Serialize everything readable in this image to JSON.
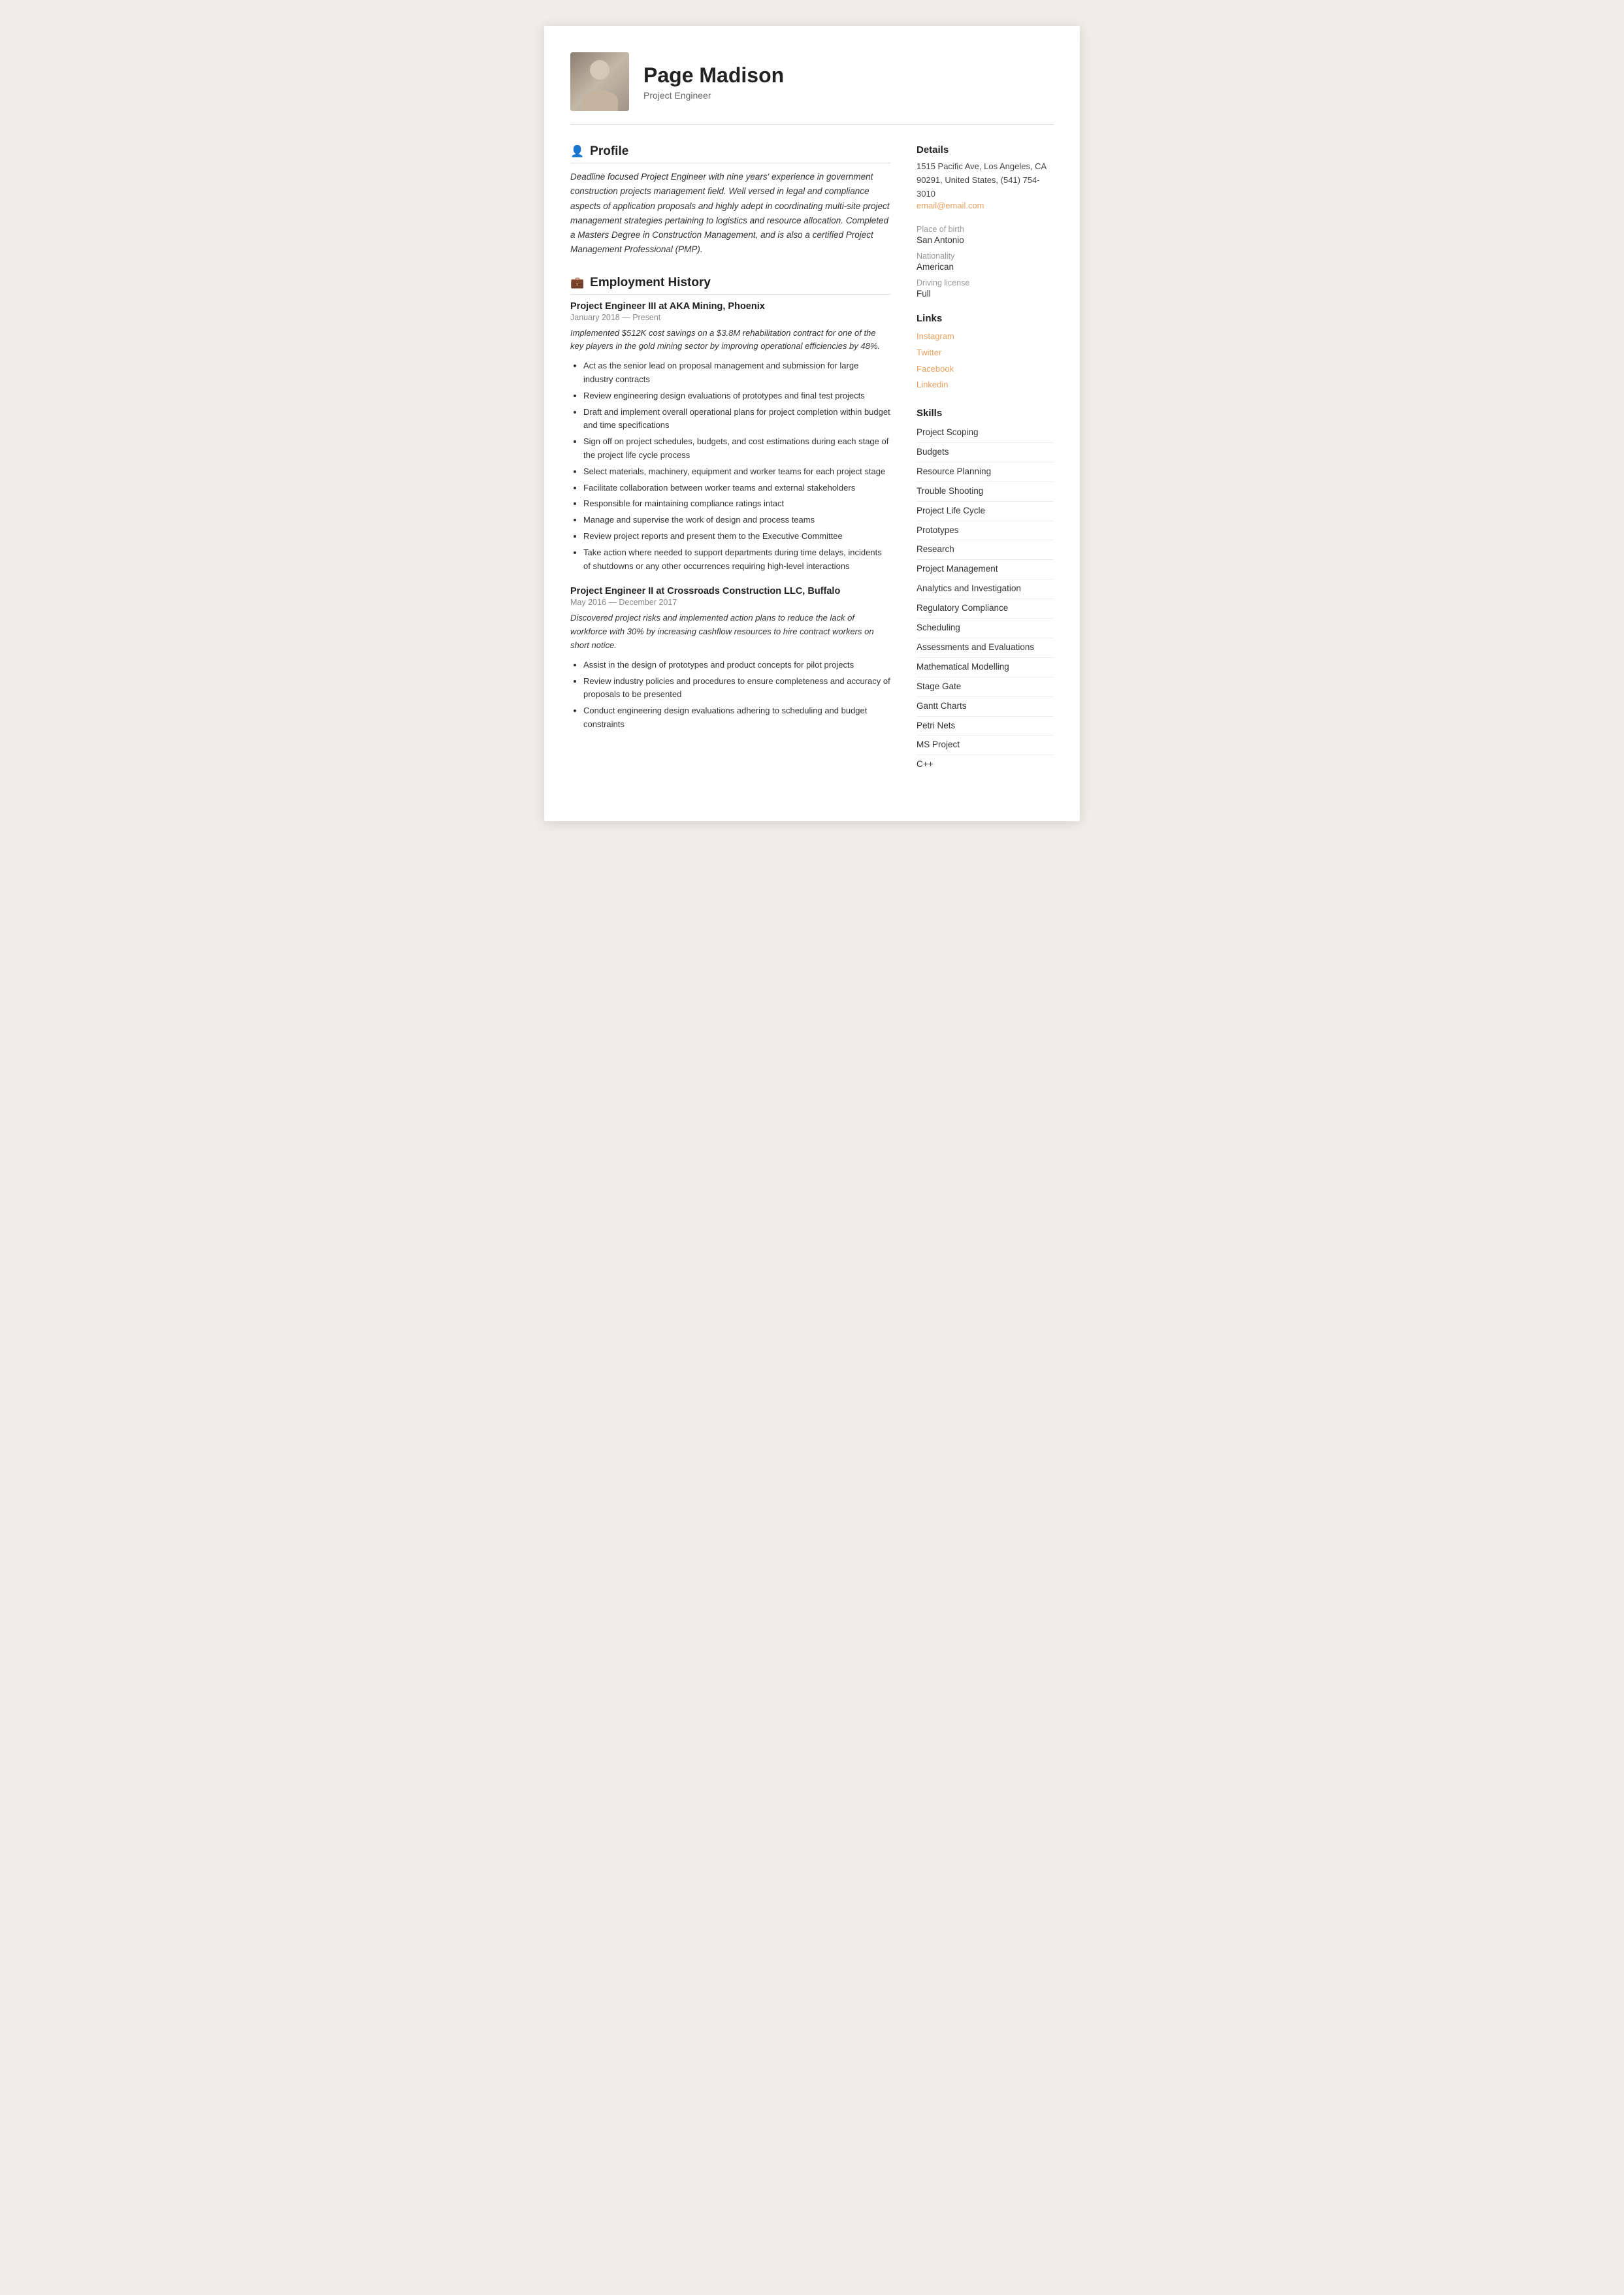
{
  "header": {
    "name": "Page Madison",
    "title": "Project Engineer"
  },
  "profile": {
    "section_title": "Profile",
    "icon": "👤",
    "text": "Deadline focused Project Engineer with nine years' experience in government construction projects management field. Well versed in legal and compliance aspects of application proposals and highly adept in coordinating multi-site project management strategies pertaining to logistics and resource allocation. Completed a Masters Degree in Construction Management, and is also a certified Project Management Professional (PMP)."
  },
  "employment": {
    "section_title": "Employment History",
    "icon": "💼",
    "jobs": [
      {
        "title": "Project Engineer III at  AKA Mining, Phoenix",
        "dates": "January 2018 — Present",
        "description": "Implemented $512K cost savings on a $3.8M rehabilitation contract for one of the key players in the gold mining sector by improving operational efficiencies by 48%.",
        "bullets": [
          "Act as the senior lead on proposal management and submission for large industry contracts",
          "Review engineering design evaluations of prototypes and final test projects",
          "Draft and implement overall operational plans for project completion within budget and time specifications",
          "Sign off on project schedules, budgets, and cost estimations during each stage of the project life cycle process",
          "Select materials, machinery, equipment and worker teams for each project stage",
          "Facilitate collaboration between worker teams and external stakeholders",
          "Responsible for maintaining compliance ratings intact",
          "Manage and supervise the work of design and process teams",
          "Review project reports and present them to the Executive Committee",
          "Take action where needed to support departments during time delays, incidents of shutdowns or any other occurrences requiring high-level interactions"
        ]
      },
      {
        "title": "Project Engineer II at  Crossroads Construction LLC, Buffalo",
        "dates": "May 2016 — December 2017",
        "description": "Discovered project risks and implemented action plans to reduce the lack of workforce with 30% by increasing cashflow resources to hire contract workers on short notice.",
        "bullets": [
          "Assist in the design of prototypes and product concepts for pilot projects",
          "Review industry policies and procedures to ensure completeness and accuracy of proposals to be presented",
          "Conduct engineering design evaluations adhering to scheduling and budget constraints"
        ]
      }
    ]
  },
  "details": {
    "section_title": "Details",
    "address": "1515 Pacific Ave, Los Angeles, CA 90291, United States, (541) 754-3010",
    "email": "email@email.com",
    "place_of_birth_label": "Place of birth",
    "place_of_birth": "San Antonio",
    "nationality_label": "Nationality",
    "nationality": "American",
    "driving_license_label": "Driving license",
    "driving_license": "Full"
  },
  "links": {
    "section_title": "Links",
    "items": [
      {
        "label": "Instagram"
      },
      {
        "label": "Twitter"
      },
      {
        "label": "Facebook"
      },
      {
        "label": "Linkedin"
      }
    ]
  },
  "skills": {
    "section_title": "Skills",
    "items": [
      "Project Scoping",
      "Budgets",
      "Resource Planning",
      "Trouble Shooting",
      "Project Life Cycle",
      "Prototypes",
      "Research",
      "Project Management",
      "Analytics and Investigation",
      "Regulatory Compliance",
      "Scheduling",
      "Assessments and Evaluations",
      "Mathematical Modelling",
      "Stage Gate",
      "Gantt Charts",
      "Petri Nets",
      "MS Project",
      "C++"
    ]
  }
}
